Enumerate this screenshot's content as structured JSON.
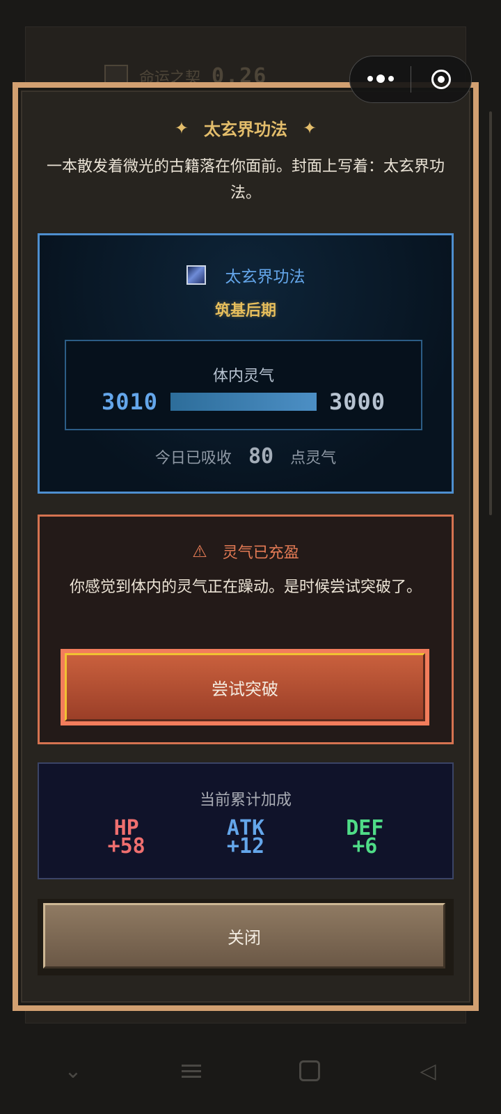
{
  "background": {
    "header_label": "命运之契",
    "header_value": "0.26"
  },
  "modal": {
    "title": "太玄界功法",
    "title_star": "✦",
    "intro": "一本散发着微光的古籍落在你面前。封面上写着：太玄界功法。",
    "technique": {
      "name": "太玄界功法",
      "realm": "筑基后期",
      "qi_label": "体内灵气",
      "qi_current": "3010",
      "qi_max": "3000",
      "qi_fill_fraction": 1.0,
      "absorb_prefix": "今日已吸收",
      "absorb_value": "80",
      "absorb_suffix": "点灵气"
    },
    "warning": {
      "icon": "⚠",
      "title": "灵气已充盈",
      "text": "你感觉到体内的灵气正在躁动。是时候尝试突破了。",
      "button_label": "尝试突破"
    },
    "bonus": {
      "title": "当前累计加成",
      "hp_label": "HP",
      "hp_value": "+58",
      "atk_label": "ATK",
      "atk_value": "+12",
      "def_label": "DEF",
      "def_value": "+6"
    },
    "close_label": "关闭"
  },
  "colors": {
    "modal_border": "#d2a071",
    "accent_gold": "#e3bd6b",
    "qi_blue": "#64a6ea",
    "warning_orange": "#e47b55",
    "hp_red": "#ef6f6f",
    "def_green": "#4fdc87"
  },
  "navbar": {
    "icons": [
      "chevron-down-icon",
      "menu-icon",
      "home-square-icon",
      "back-triangle-icon"
    ]
  }
}
